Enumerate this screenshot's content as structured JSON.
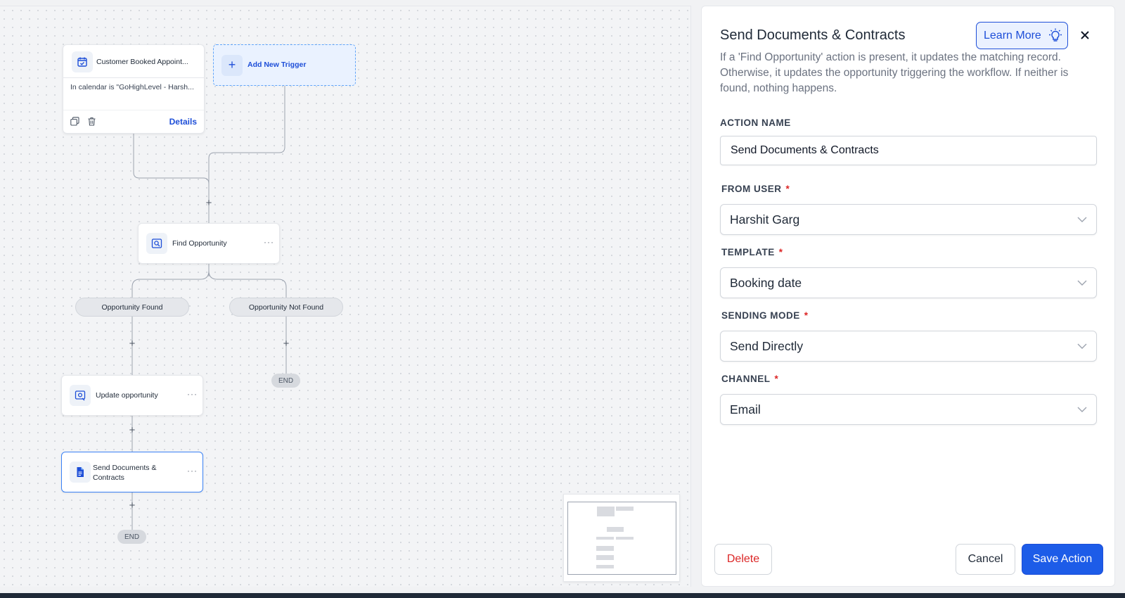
{
  "canvas": {
    "trigger_node": {
      "title": "Customer Booked Appoint...",
      "condition": "In calendar is \"GoHighLevel - Harsh...",
      "details_label": "Details"
    },
    "add_trigger_label": "Add New Trigger",
    "find_opportunity_label": "Find Opportunity",
    "branch_found_label": "Opportunity Found",
    "branch_not_found_label": "Opportunity Not Found",
    "update_opportunity_label": "Update opportunity",
    "send_documents_label_line1": "Send Documents &",
    "send_documents_label_line2": "Contracts",
    "end_label": "END",
    "plus_glyph": "+",
    "more_glyph": "···"
  },
  "panel": {
    "title": "Send Documents & Contracts",
    "learn_more_label": "Learn More",
    "description": "If a 'Find Opportunity' action is present, it updates the matching record. Otherwise, it updates the opportunity triggering the workflow. If neither is found, nothing happens.",
    "action_name_label": "ACTION NAME",
    "action_name_value": "Send Documents & Contracts",
    "from_user_label": "FROM USER",
    "from_user_value": "Harshit Garg",
    "template_label": "TEMPLATE",
    "template_value": "Booking date",
    "sending_mode_label": "SENDING MODE",
    "sending_mode_value": "Send Directly",
    "channel_label": "CHANNEL",
    "channel_value": "Email",
    "required_mark": "*",
    "delete_label": "Delete",
    "cancel_label": "Cancel",
    "save_label": "Save Action"
  },
  "colors": {
    "primary": "#1d5ce8",
    "danger": "#dc2626"
  }
}
